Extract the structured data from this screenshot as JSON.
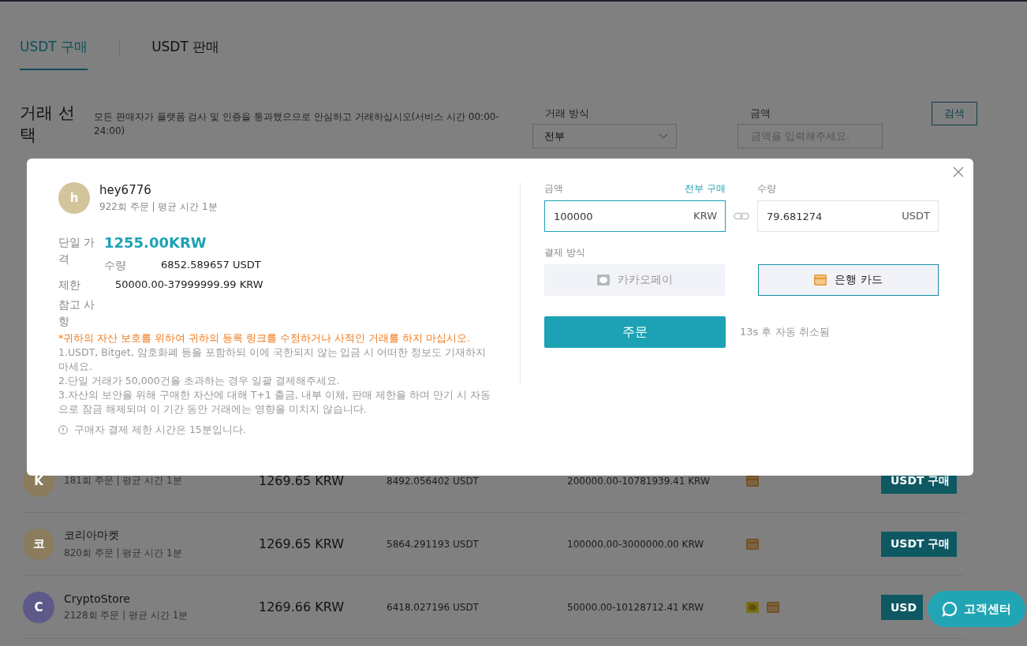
{
  "tabs": [
    {
      "label": "USDT 구매",
      "selected": true
    },
    {
      "label": "USDT 판매",
      "selected": false
    }
  ],
  "filter": {
    "title": "거래 선택",
    "notice": "모든 판매자가 플랫폼 검사 및 인증을 통과했으므로 안심하고 거래하십시오(서비스 시간 00:00-24:00)",
    "trade_method": {
      "label": "거래 방식",
      "value": "전부"
    },
    "amount": {
      "label": "금액",
      "placeholder": "금액을 입력해주세요."
    },
    "search_button": "검색"
  },
  "rows": [
    {
      "avatar": "K",
      "color": "#8a7c5c",
      "stats": "181회 주문 | 평균 시간 1분",
      "price": "1269.65 KRW",
      "quantity": "8492.056402 USDT",
      "limit": "200000.00-10781939.41 KRW",
      "payments": [
        {
          "kind": "card"
        }
      ],
      "button": "USDT 구매"
    },
    {
      "avatar": "코",
      "color": "#8a7c5c",
      "name": "코리아마켓",
      "stats": "820회 주문 | 평균 시간 1분",
      "price": "1269.65 KRW",
      "quantity": "5864.291193 USDT",
      "limit": "100000.00-3000000.00 KRW",
      "payments": [
        {
          "kind": "card"
        }
      ],
      "button": "USDT 구매"
    },
    {
      "avatar": "C",
      "color": "#5d5a8a",
      "name": "CryptoStore",
      "stats": "2128회 주문 | 평균 시간 1분",
      "price": "1269.66 KRW",
      "quantity": "6418.027196 USDT",
      "limit": "50000.00-10128712.41 KRW",
      "payments": [
        {
          "kind": "kakao"
        },
        {
          "kind": "card"
        }
      ],
      "button": "USD"
    }
  ],
  "modal": {
    "seller": {
      "avatar": "h",
      "color": "#d4c49c",
      "name": "hey6776",
      "stats": "922회 주문 | 평균 시간 1분"
    },
    "unit_price": {
      "label": "단일 가격",
      "value": "1255.00KRW"
    },
    "quantity": {
      "label": "수량",
      "value": "6852.589657 USDT"
    },
    "limit": {
      "label": "제한",
      "value": "50000.00-37999999.99 KRW"
    },
    "notes": {
      "label": "참고 사항",
      "warning": "*귀하의 자산 보호를 위하여 귀하의 등록 링크를 수정하거나 사적인 거래를 하지 마십시오.",
      "lines": [
        "1.USDT, Bitget, 암호화폐 등을 포함하되 이에 국한되지 않는 입금 시 어떠한 정보도 기재하지 마세요.",
        "2.단일 거래가 50,000건을 초과하는 경우 일괄 결제해주세요.",
        "3.자산의 보안을 위해 구매한 자산에 대해 T+1 출금, 내부 이체, 판매 제한을 하며 만기 시 자동으로 잠금 해제되며 이 기간 동안 거래에는 영향을 미치지 않습니다."
      ]
    },
    "time_limit": "구매자 결제 제한 시간은 15분입니다.",
    "amount": {
      "label": "금액",
      "link": "전부 구매",
      "value": "100000",
      "unit": "KRW"
    },
    "receive": {
      "label": "수량",
      "value": "79.681274",
      "unit": "USDT"
    },
    "payment_label": "결제 방식",
    "methods": [
      {
        "kind": "kakao",
        "label": "카카오페이",
        "selected": false
      },
      {
        "kind": "card",
        "label": "은행 카드",
        "selected": true
      }
    ],
    "order_button": "주문",
    "countdown": "13s 후 자동 취소됨"
  },
  "chat_button": "고객센터"
}
